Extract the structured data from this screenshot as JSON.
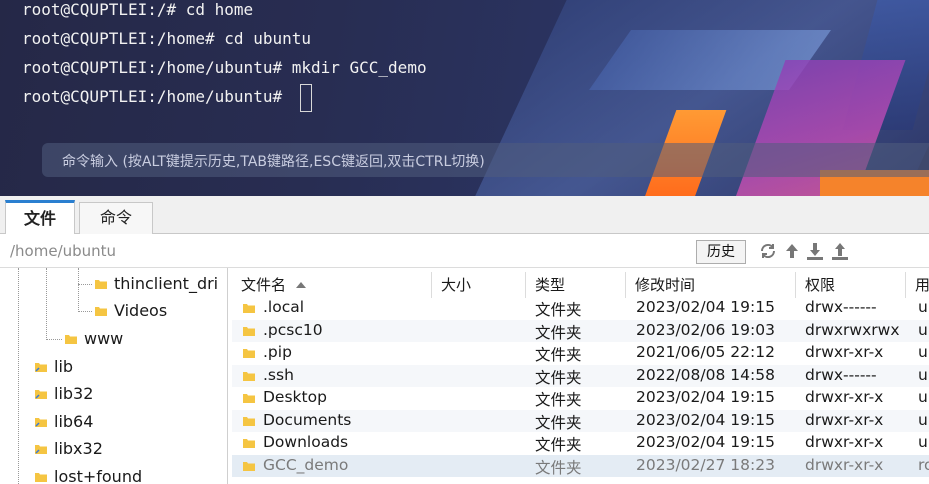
{
  "terminal": {
    "lines": [
      "root@CQUPTLEI:/# cd home",
      "root@CQUPTLEI:/home# cd ubuntu",
      "root@CQUPTLEI:/home/ubuntu# mkdir GCC_demo",
      "root@CQUPTLEI:/home/ubuntu# "
    ],
    "input_placeholder": "命令输入 (按ALT键提示历史,TAB键路径,ESC键返回,双击CTRL切换)"
  },
  "tabs": [
    {
      "label": "文件",
      "active": true
    },
    {
      "label": "命令",
      "active": false
    }
  ],
  "pathbar": {
    "path": "/home/ubuntu",
    "history_label": "历史",
    "icons": [
      "refresh-icon",
      "up-arrow-icon",
      "download-icon",
      "upload-icon"
    ]
  },
  "tree": {
    "items": [
      {
        "label": "thinclient_dri"
      },
      {
        "label": "Videos"
      },
      {
        "label": "www"
      },
      {
        "label": "lib"
      },
      {
        "label": "lib32"
      },
      {
        "label": "lib64"
      },
      {
        "label": "libx32"
      },
      {
        "label": "lost+found"
      }
    ]
  },
  "filelist": {
    "columns": [
      "文件名",
      "大小",
      "类型",
      "修改时间",
      "权限",
      "用"
    ],
    "rows": [
      {
        "name": ".local",
        "size": "",
        "type": "文件夹",
        "mtime": "2023/02/04 19:15",
        "perm": "drwx------",
        "owner": "u"
      },
      {
        "name": ".pcsc10",
        "size": "",
        "type": "文件夹",
        "mtime": "2023/02/06 19:03",
        "perm": "drwxrwxrwx",
        "owner": "u"
      },
      {
        "name": ".pip",
        "size": "",
        "type": "文件夹",
        "mtime": "2021/06/05 22:12",
        "perm": "drwxr-xr-x",
        "owner": "u"
      },
      {
        "name": ".ssh",
        "size": "",
        "type": "文件夹",
        "mtime": "2022/08/08 14:58",
        "perm": "drwx------",
        "owner": "u"
      },
      {
        "name": "Desktop",
        "size": "",
        "type": "文件夹",
        "mtime": "2023/02/04 19:15",
        "perm": "drwxr-xr-x",
        "owner": "u"
      },
      {
        "name": "Documents",
        "size": "",
        "type": "文件夹",
        "mtime": "2023/02/04 19:15",
        "perm": "drwxr-xr-x",
        "owner": "u"
      },
      {
        "name": "Downloads",
        "size": "",
        "type": "文件夹",
        "mtime": "2023/02/04 19:15",
        "perm": "drwxr-xr-x",
        "owner": "u"
      },
      {
        "name": "GCC_demo",
        "size": "",
        "type": "文件夹",
        "mtime": "2023/02/27 18:23",
        "perm": "drwxr-xr-x",
        "owner": "ro",
        "selected": true
      }
    ]
  },
  "colors": {
    "accent": "#2a7fd0",
    "folder": "#f5c542",
    "selected_row": "#e4ecf4"
  }
}
